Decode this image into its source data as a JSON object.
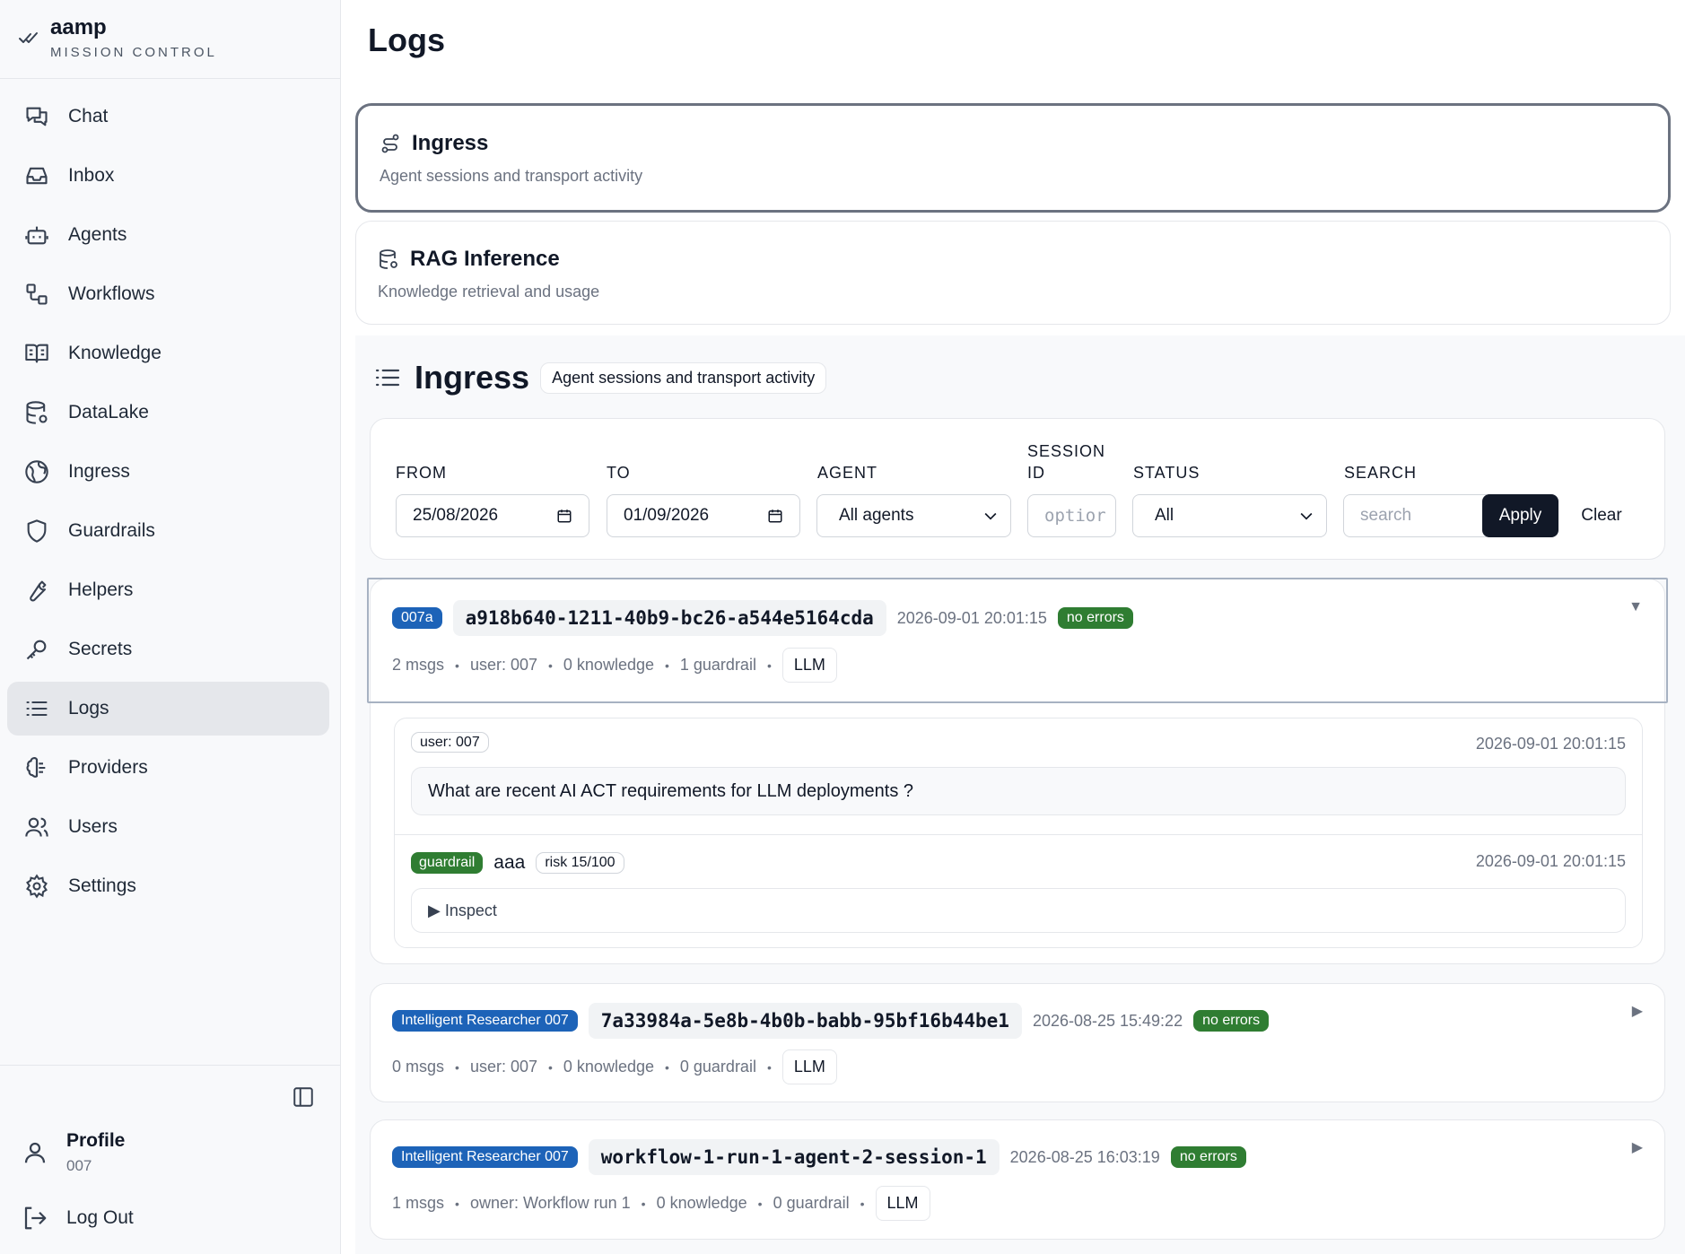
{
  "brand": {
    "name": "aamp",
    "subtitle": "MISSION CONTROL"
  },
  "nav": [
    {
      "label": "Chat",
      "icon": "chat-icon"
    },
    {
      "label": "Inbox",
      "icon": "inbox-icon"
    },
    {
      "label": "Agents",
      "icon": "bot-icon"
    },
    {
      "label": "Workflows",
      "icon": "workflow-icon"
    },
    {
      "label": "Knowledge",
      "icon": "book-icon"
    },
    {
      "label": "DataLake",
      "icon": "database-icon"
    },
    {
      "label": "Ingress",
      "icon": "globe-icon"
    },
    {
      "label": "Guardrails",
      "icon": "shield-icon"
    },
    {
      "label": "Helpers",
      "icon": "wrench-icon"
    },
    {
      "label": "Secrets",
      "icon": "key-icon"
    },
    {
      "label": "Logs",
      "icon": "list-icon",
      "active": true
    },
    {
      "label": "Providers",
      "icon": "brain-icon"
    },
    {
      "label": "Users",
      "icon": "users-icon"
    },
    {
      "label": "Settings",
      "icon": "gear-icon"
    }
  ],
  "profile": {
    "name": "Profile",
    "id": "007"
  },
  "logout_label": "Log Out",
  "page_title": "Logs",
  "sources": [
    {
      "title": "Ingress",
      "desc": "Agent sessions and transport activity",
      "icon": "route-icon",
      "selected": true
    },
    {
      "title": "RAG Inference",
      "desc": "Knowledge retrieval and usage",
      "icon": "database-icon"
    }
  ],
  "panel": {
    "title": "Ingress",
    "desc": "Agent sessions and transport activity"
  },
  "filters": {
    "from_label": "FROM",
    "from_value": "25/08/2026",
    "to_label": "TO",
    "to_value": "01/09/2026",
    "agent_label": "AGENT",
    "agent_value": "All agents",
    "session_label_1": "SESSION",
    "session_label_2": "ID",
    "session_placeholder": "optior",
    "status_label": "STATUS",
    "status_value": "All",
    "search_label": "SEARCH",
    "search_placeholder": "search",
    "apply": "Apply",
    "clear": "Clear"
  },
  "sessions": [
    {
      "agent": "007a",
      "id": "a918b640-1211-40b9-bc26-a544e5164cda",
      "ts": "2026-09-01 20:01:15",
      "status": "no errors",
      "msgs": "2 msgs",
      "user": "user: 007",
      "knowledge": "0 knowledge",
      "guardrail": "1 guardrail",
      "llm": "LLM",
      "caret": "▼",
      "message": {
        "role": "user: 007",
        "ts": "2026-09-01 20:01:15",
        "text": "What are recent AI ACT requirements for LLM deployments ?"
      },
      "guard": {
        "badge": "guardrail",
        "name": "aaa",
        "risk": "risk 15/100",
        "ts": "2026-09-01 20:01:15",
        "inspect": "▶ Inspect"
      }
    },
    {
      "agent": "Intelligent Researcher 007",
      "id": "7a33984a-5e8b-4b0b-babb-95bf16b44be1",
      "ts": "2026-08-25 15:49:22",
      "status": "no errors",
      "msgs": "0 msgs",
      "user": "user: 007",
      "knowledge": "0 knowledge",
      "guardrail": "0 guardrail",
      "llm": "LLM",
      "caret": "▶"
    },
    {
      "agent": "Intelligent Researcher 007",
      "id": "workflow-1-run-1-agent-2-session-1",
      "ts": "2026-08-25 16:03:19",
      "status": "no errors",
      "msgs": "1 msgs",
      "user": "owner: Workflow run 1",
      "knowledge": "0 knowledge",
      "guardrail": "0 guardrail",
      "llm": "LLM",
      "caret": "▶"
    }
  ],
  "colors": {
    "agent_badge": "#1d63b8",
    "status_ok": "#2f7d32",
    "dark_button": "#111827",
    "active_nav": "#e5e7eb"
  }
}
